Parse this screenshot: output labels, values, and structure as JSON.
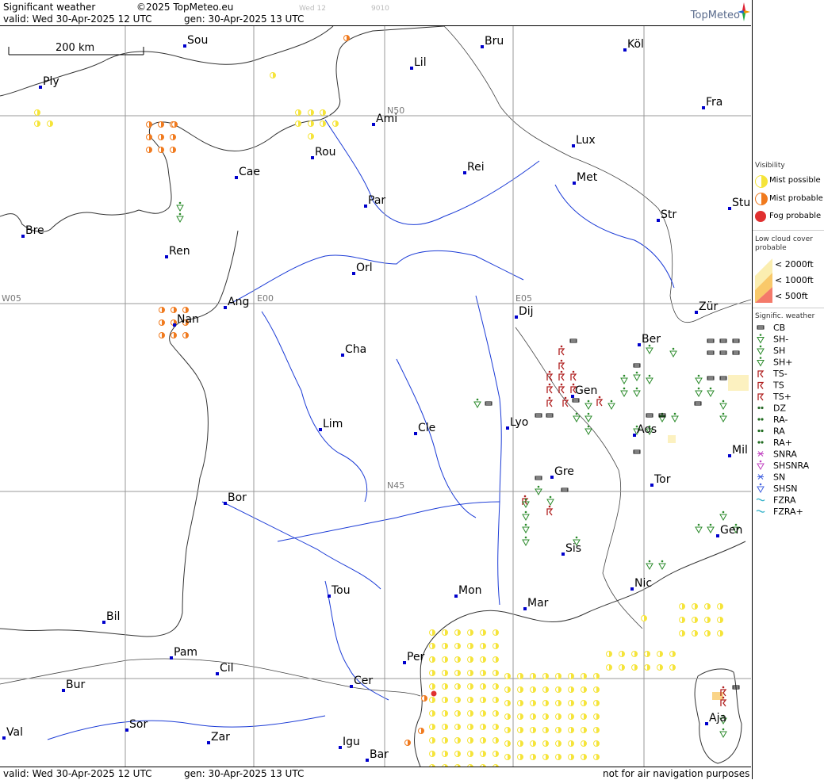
{
  "header": {
    "title": "Significant weather",
    "copyright": "©2025 TopMeteo.eu",
    "valid": "valid:  Wed  30-Apr-2025  12 UTC",
    "gen": "gen:  30-Apr-2025 13 UTC",
    "faint_day": "Wed 12",
    "faint_code": "9010",
    "brand": "TopMeteo"
  },
  "footer": {
    "valid": "valid:  Wed  30-Apr-2025  12 UTC",
    "gen": "gen:  30-Apr-2025 13 UTC",
    "disclaimer": "not for air navigation purposes"
  },
  "map": {
    "scale_label": "200 km",
    "grid_labels": {
      "n50": "N50",
      "n45": "N45",
      "w05": "W05",
      "e00": "E00",
      "e05": "E05"
    },
    "cities": [
      "Sou",
      "Bru",
      "Köl",
      "Ply",
      "Lil",
      "Fra",
      "Ami",
      "Lux",
      "Rou",
      "Cae",
      "Rei",
      "Met",
      "Par",
      "Stu",
      "Str",
      "Bre",
      "Ren",
      "Orl",
      "Ang",
      "Nan",
      "Dij",
      "Zür",
      "Cha",
      "Ber",
      "Gen",
      "Lyo",
      "Lim",
      "Cle",
      "Aos",
      "Mil",
      "Gre",
      "Tor",
      "Bor",
      "Sis",
      "Gen",
      "Nic",
      "Tou",
      "Mon",
      "Mar",
      "Bil",
      "Pam",
      "Cil",
      "Per",
      "Bur",
      "Cer",
      "Aja",
      "Sor",
      "Val",
      "Zar",
      "Igu",
      "Bar"
    ],
    "colors": {
      "mist_possible": "#f5e43a",
      "mist_probable": "#f07a1e",
      "fog_probable": "#e03030",
      "shower": "#2a8a2a",
      "thunder": "#b02020",
      "city": "#0000cc"
    }
  },
  "legend": {
    "visibility_title": "Visibility",
    "visibility": [
      "Mist possible",
      "Mist probable",
      "Fog probable"
    ],
    "cloud_title": "Low cloud cover probable",
    "cloud": [
      "< 2000ft",
      "< 1000ft",
      "<  500ft"
    ],
    "weather_title": "Signific. weather",
    "weather": [
      "CB",
      "SH-",
      "SH",
      "SH+",
      "TS-",
      "TS",
      "TS+",
      "DZ",
      "RA-",
      "RA",
      "RA+",
      "SNRA",
      "SHSNRA",
      "SN",
      "SHSN",
      "FZRA",
      "FZRA+"
    ]
  }
}
